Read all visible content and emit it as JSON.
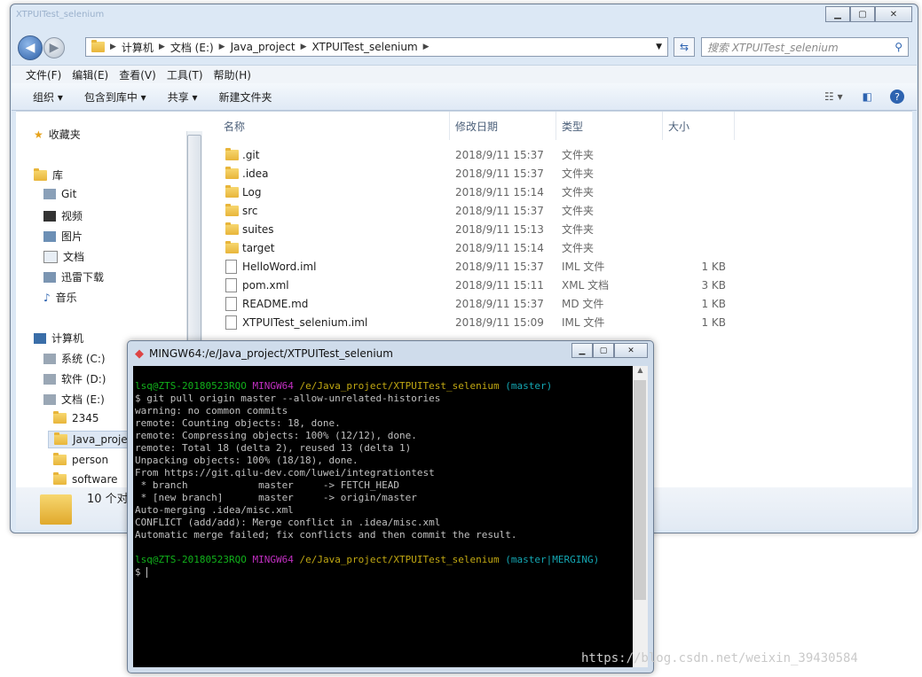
{
  "explorer": {
    "title_ghost": "XTPUITest_selenium",
    "address": {
      "crumbs": [
        "计算机",
        "文档 (E:)",
        "Java_project",
        "XTPUITest_selenium"
      ]
    },
    "search_placeholder": "搜索 XTPUITest_selenium",
    "menu": [
      "文件(F)",
      "编辑(E)",
      "查看(V)",
      "工具(T)",
      "帮助(H)"
    ],
    "toolbar": {
      "organize": "组织 ▾",
      "include": "包含到库中 ▾",
      "share": "共享 ▾",
      "new_folder": "新建文件夹"
    },
    "nav": {
      "favorites": "收藏夹",
      "libraries": "库",
      "lib_items": [
        "Git",
        "视频",
        "图片",
        "文档",
        "迅雷下载",
        "音乐"
      ],
      "computer": "计算机",
      "drives": [
        "系统 (C:)",
        "软件 (D:)",
        "文档 (E:)"
      ],
      "e_folders": [
        "2345",
        "Java_proje",
        "person",
        "software"
      ]
    },
    "columns": {
      "name": "名称",
      "date": "修改日期",
      "type": "类型",
      "size": "大小"
    },
    "files": [
      {
        "name": ".git",
        "date": "2018/9/11 15:37",
        "type": "文件夹",
        "size": ""
      },
      {
        "name": ".idea",
        "date": "2018/9/11 15:37",
        "type": "文件夹",
        "size": ""
      },
      {
        "name": "Log",
        "date": "2018/9/11 15:14",
        "type": "文件夹",
        "size": ""
      },
      {
        "name": "src",
        "date": "2018/9/11 15:37",
        "type": "文件夹",
        "size": ""
      },
      {
        "name": "suites",
        "date": "2018/9/11 15:13",
        "type": "文件夹",
        "size": ""
      },
      {
        "name": "target",
        "date": "2018/9/11 15:14",
        "type": "文件夹",
        "size": ""
      },
      {
        "name": "HelloWord.iml",
        "date": "2018/9/11 15:37",
        "type": "IML 文件",
        "size": "1 KB"
      },
      {
        "name": "pom.xml",
        "date": "2018/9/11 15:11",
        "type": "XML 文档",
        "size": "3 KB"
      },
      {
        "name": "README.md",
        "date": "2018/9/11 15:37",
        "type": "MD 文件",
        "size": "1 KB"
      },
      {
        "name": "XTPUITest_selenium.iml",
        "date": "2018/9/11 15:09",
        "type": "IML 文件",
        "size": "1 KB"
      }
    ],
    "status": "10 个对"
  },
  "terminal": {
    "title": "MINGW64:/e/Java_project/XTPUITest_selenium",
    "prompt1": {
      "user": "lsq@ZTS-20180523RQO",
      "env": "MINGW64",
      "path": "/e/Java_project/XTPUITest_selenium",
      "branch": "(master)"
    },
    "lines": [
      "$ git pull origin master --allow-unrelated-histories",
      "warning: no common commits",
      "remote: Counting objects: 18, done.",
      "remote: Compressing objects: 100% (12/12), done.",
      "remote: Total 18 (delta 2), reused 13 (delta 1)",
      "Unpacking objects: 100% (18/18), done.",
      "From https://git.qilu-dev.com/luwei/integrationtest",
      " * branch            master     -> FETCH_HEAD",
      " * [new branch]      master     -> origin/master",
      "Auto-merging .idea/misc.xml",
      "CONFLICT (add/add): Merge conflict in .idea/misc.xml",
      "Automatic merge failed; fix conflicts and then commit the result."
    ],
    "prompt2": {
      "user": "lsq@ZTS-20180523RQO",
      "env": "MINGW64",
      "path": "/e/Java_project/XTPUITest_selenium",
      "branch": "(master|MERGING)"
    },
    "input": "$ "
  },
  "watermark": "https://blog.csdn.net/weixin_39430584",
  "colors": {
    "prompt_user": "#11b11b",
    "prompt_env": "#c12fc1",
    "prompt_path": "#c1a812",
    "prompt_branch": "#14a7b3"
  }
}
